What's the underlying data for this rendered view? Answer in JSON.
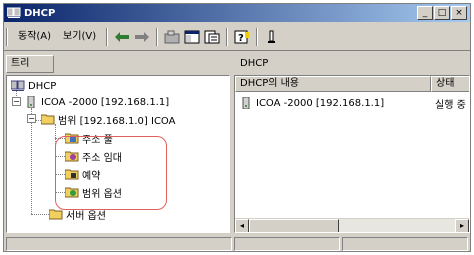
{
  "window": {
    "title": "DHCP"
  },
  "menu": {
    "action": "동작(A)",
    "view": "보기(V)"
  },
  "title_buttons": {
    "minimize": "_",
    "maximize": "□",
    "close": "×"
  },
  "left_panel": {
    "tab_label": "트리"
  },
  "tree": {
    "root": "DHCP",
    "server": "ICOA -2000 [192.168.1.1]",
    "scope": "범위 [192.168.1.0] ICOA",
    "scope_children": [
      "주소 풀",
      "주소 임대",
      "예약",
      "범위 옵션"
    ],
    "server_options": "서버 옵션"
  },
  "right_panel": {
    "title": "DHCP",
    "columns": [
      "DHCP의 내용",
      "상태"
    ],
    "rows": [
      {
        "name": "ICOA -2000 [192.168.1.1]",
        "status": "실행 중"
      }
    ]
  },
  "colors": {
    "title_bar_start": "#0a246a",
    "title_bar_end": "#a6caf0",
    "highlight": "#e06060"
  }
}
